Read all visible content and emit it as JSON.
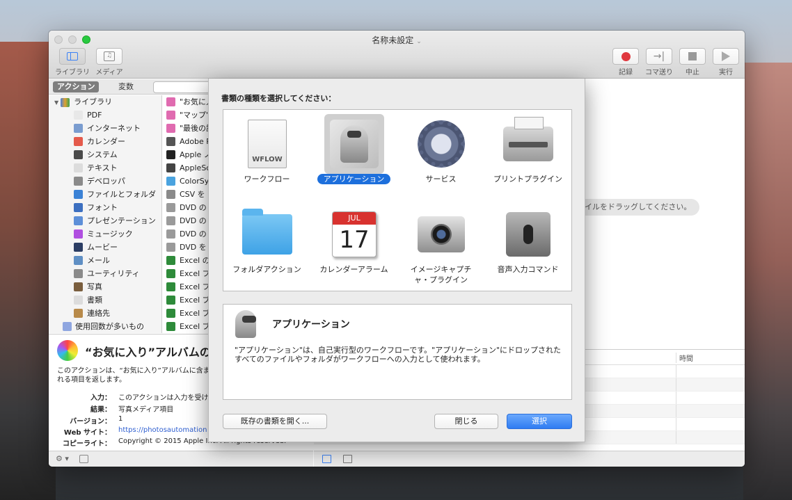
{
  "window": {
    "title": "名称未設定",
    "title_chevron": "⌄"
  },
  "toolbar": {
    "library_label": "ライブラリ",
    "media_label": "メディア",
    "record_label": "記録",
    "step_label": "コマ送り",
    "stop_label": "中止",
    "run_label": "実行"
  },
  "library_tabs": {
    "actions": "アクション",
    "variables": "変数"
  },
  "library": {
    "root_label": "ライブラリ",
    "items": [
      {
        "label": "PDF",
        "color": "#e8e8e8"
      },
      {
        "label": "インターネット",
        "color": "#7a9ccf"
      },
      {
        "label": "カレンダー",
        "color": "#e45a4b"
      },
      {
        "label": "システム",
        "color": "#4a4a4a"
      },
      {
        "label": "テキスト",
        "color": "#dcdcdc"
      },
      {
        "label": "デベロッパ",
        "color": "#8a8a8a"
      },
      {
        "label": "ファイルとフォルダ",
        "color": "#3b82d6"
      },
      {
        "label": "フォント",
        "color": "#3c6fc0"
      },
      {
        "label": "プレゼンテーション",
        "color": "#5d8fd8"
      },
      {
        "label": "ミュージック",
        "color": "#b04fe0"
      },
      {
        "label": "ムービー",
        "color": "#2b3d63"
      },
      {
        "label": "メール",
        "color": "#5f8fc4"
      },
      {
        "label": "ユーティリティ",
        "color": "#8a8a8a"
      },
      {
        "label": "写真",
        "color": "#7a5e3e"
      },
      {
        "label": "書類",
        "color": "#dcdcdc"
      },
      {
        "label": "連絡先",
        "color": "#b88a4a"
      }
    ],
    "most_used_label": "使用回数が多いもの"
  },
  "actions": [
    {
      "label": "\"お気に入",
      "color": "#e06bb0"
    },
    {
      "label": "\"マップ\"",
      "color": "#e06bb0"
    },
    {
      "label": "\"最後の読",
      "color": "#e06bb0"
    },
    {
      "label": "Adobe P",
      "color": "#555"
    },
    {
      "label": "Apple ノ",
      "color": "#222"
    },
    {
      "label": "AppleSc",
      "color": "#444"
    },
    {
      "label": "ColorSy",
      "color": "#4aa3df"
    },
    {
      "label": "CSV を",
      "color": "#8a8a8a"
    },
    {
      "label": "DVD の",
      "color": "#9a9a9a"
    },
    {
      "label": "DVD の",
      "color": "#9a9a9a"
    },
    {
      "label": "DVD の",
      "color": "#9a9a9a"
    },
    {
      "label": "DVD を",
      "color": "#9a9a9a"
    },
    {
      "label": "Excel の",
      "color": "#2e8b3a"
    },
    {
      "label": "Excel フ",
      "color": "#2e8b3a"
    },
    {
      "label": "Excel フ",
      "color": "#2e8b3a"
    },
    {
      "label": "Excel ブ",
      "color": "#2e8b3a"
    },
    {
      "label": "Excel ブ",
      "color": "#2e8b3a"
    },
    {
      "label": "Excel ブ",
      "color": "#2e8b3a"
    }
  ],
  "description": {
    "title": "“お気に入り”アルバムの",
    "text": "このアクションは、“お気に入り”アルバムに含まれる項目を返します。",
    "input_key": "入力：",
    "input_val": "このアクションは入力を受け付",
    "result_key": "結果：",
    "result_val": "写真メディア項目",
    "version_key": "バージョン：",
    "version_val": "1",
    "web_key": "Web サイト：",
    "web_val": "https://photosautomation",
    "copyright_key": "コピーライト：",
    "copyright_val": "Copyright © 2015 Apple Inc. All rights reserved.",
    "gear_icon": "⚙ ▾"
  },
  "workflow": {
    "drop_hint": "イルをドラッグしてください。"
  },
  "log": {
    "time_header": "時間"
  },
  "sheet": {
    "prompt": "書類の種類を選択してください：",
    "types": [
      {
        "label": "ワークフロー",
        "icon": "workflow-document-icon",
        "badge": "WFLOW"
      },
      {
        "label": "アプリケーション",
        "icon": "automator-robot-icon"
      },
      {
        "label": "サービス",
        "icon": "gear-icon"
      },
      {
        "label": "プリントプラグイン",
        "icon": "printer-icon"
      },
      {
        "label": "フォルダアクション",
        "icon": "folder-icon"
      },
      {
        "label": "カレンダーアラーム",
        "icon": "calendar-icon",
        "month": "JUL",
        "day": "17"
      },
      {
        "label": "イメージキャプチャ・プラグイン",
        "icon": "camera-icon"
      },
      {
        "label": "音声入力コマンド",
        "icon": "microphone-icon"
      }
    ],
    "selected_index": 1,
    "detail_title": "アプリケーション",
    "detail_text": "\"アプリケーション\"は、自己実行型のワークフローです。\"アプリケーション\"にドロップされたすべてのファイルやフォルダがワークフローへの入力として使われます。",
    "open_existing": "既存の書類を開く...",
    "close": "閉じる",
    "choose": "選択"
  }
}
